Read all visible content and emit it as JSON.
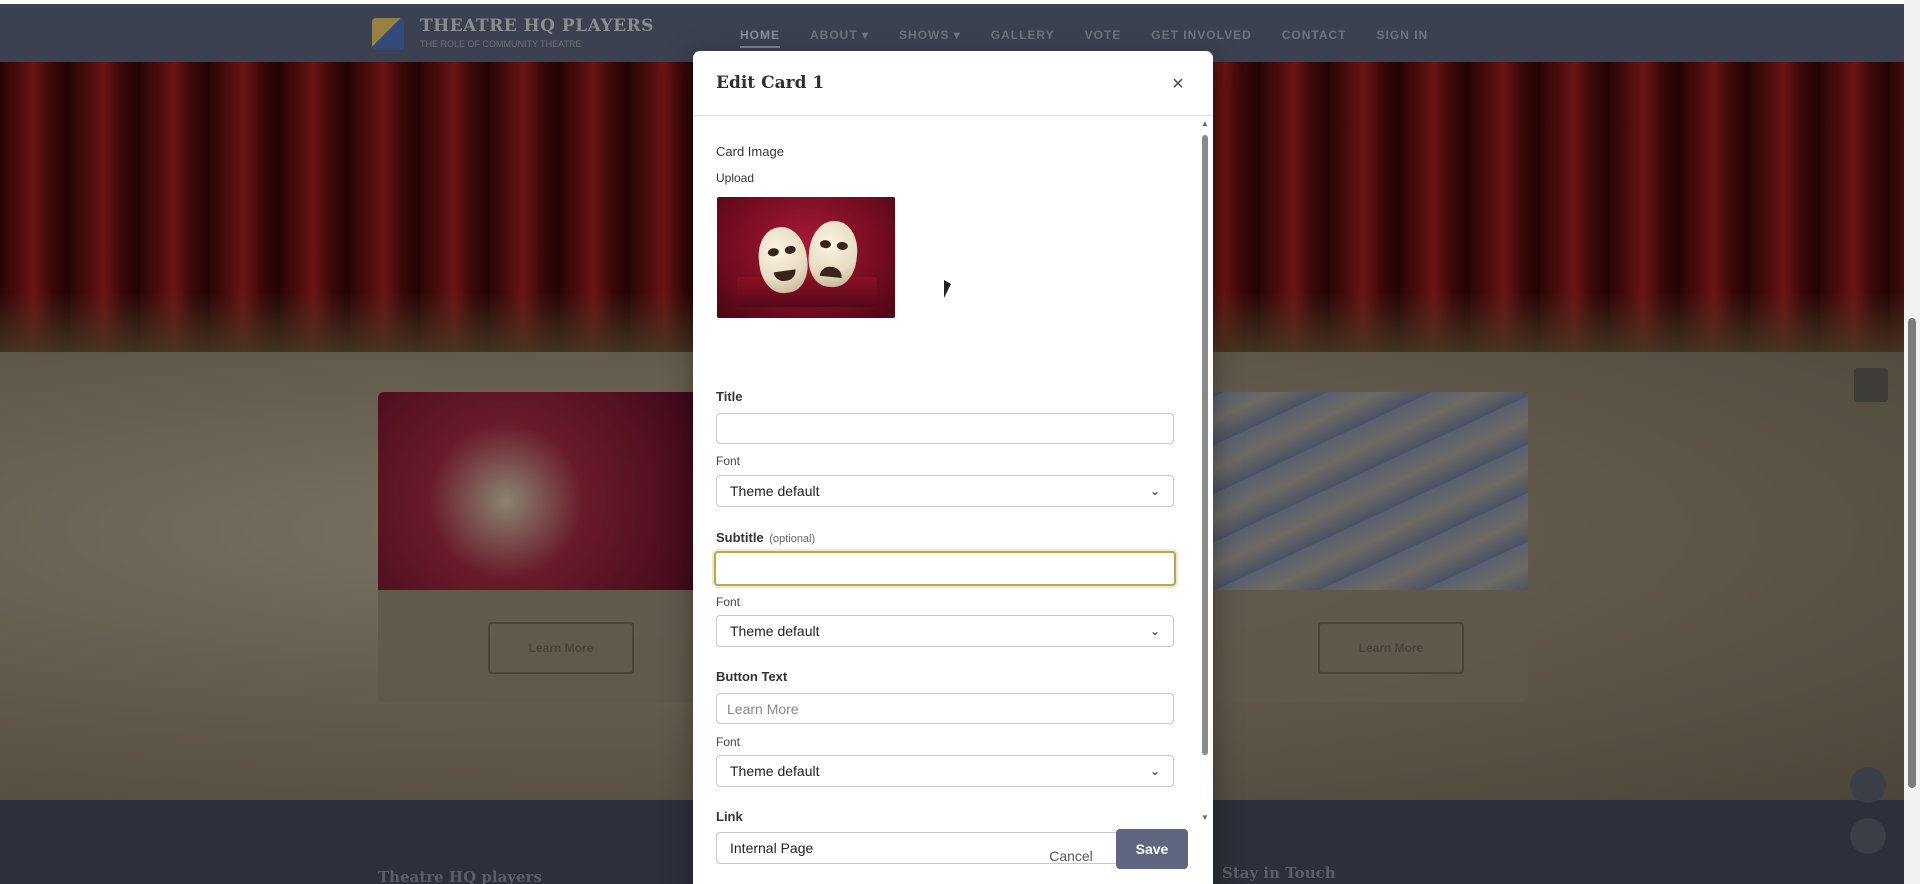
{
  "site": {
    "brand_name": "THEATRE HQ PLAYERS",
    "brand_tagline": "THE ROLE OF COMMUNITY THEATRE",
    "nav": [
      "HOME",
      "ABOUT ▾",
      "SHOWS ▾",
      "GALLERY",
      "VOTE",
      "GET INVOLVED",
      "CONTACT",
      "SIGN IN"
    ],
    "card_button": "Learn More",
    "footer_brand": "Theatre HQ players",
    "footer_heading": "Stay in Touch"
  },
  "modal": {
    "title": "Edit Card 1",
    "close_label": "×",
    "card_image_label": "Card Image",
    "upload_label": "Upload",
    "title_label": "Title",
    "title_value": "",
    "title_font_label": "Font",
    "title_font_value": "Theme default",
    "subtitle_label": "Subtitle",
    "subtitle_optional": "(optional)",
    "subtitle_value": "",
    "subtitle_font_label": "Font",
    "subtitle_font_value": "Theme default",
    "button_text_label": "Button Text",
    "button_text_placeholder": "Learn More",
    "button_font_label": "Font",
    "button_font_value": "Theme default",
    "link_label": "Link",
    "link_value": "Internal Page",
    "cancel_label": "Cancel",
    "save_label": "Save"
  },
  "colors": {
    "focus_ring": "#b9a74c",
    "save_button": "#5f6680",
    "nav_bg": "#3b4151"
  },
  "icons": {
    "close": "close-icon",
    "select": "chevron-down-icon"
  }
}
